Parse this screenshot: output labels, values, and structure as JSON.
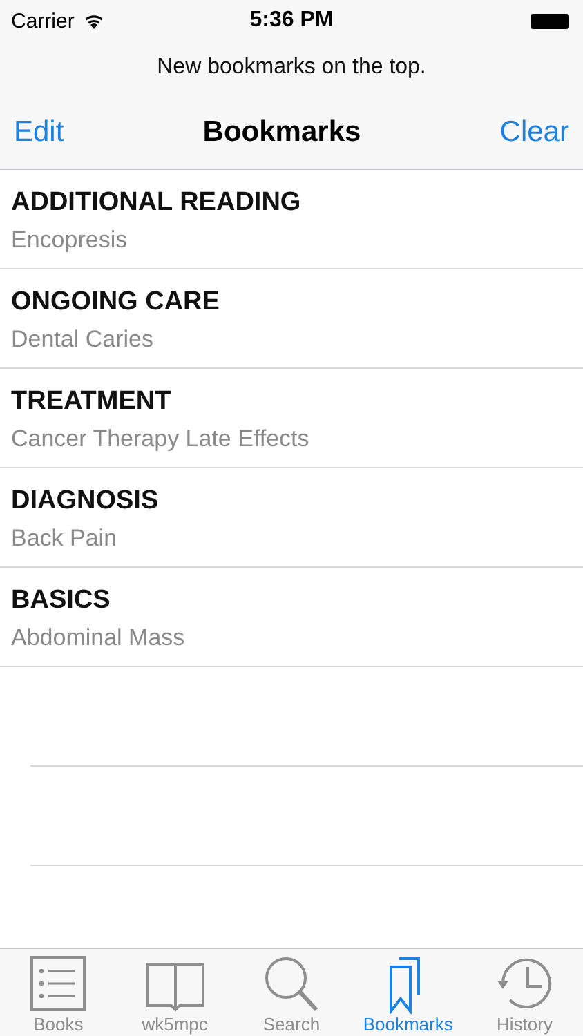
{
  "status_bar": {
    "carrier": "Carrier",
    "time": "5:36 PM"
  },
  "prompt": "New bookmarks on the top.",
  "nav": {
    "left": "Edit",
    "title": "Bookmarks",
    "right": "Clear"
  },
  "bookmarks": [
    {
      "section": "ADDITIONAL READING",
      "topic": "Encopresis"
    },
    {
      "section": "ONGOING CARE",
      "topic": "Dental Caries"
    },
    {
      "section": "TREATMENT",
      "topic": "Cancer Therapy Late Effects"
    },
    {
      "section": "DIAGNOSIS",
      "topic": "Back Pain"
    },
    {
      "section": "BASICS",
      "topic": "Abdominal Mass"
    }
  ],
  "tabs": [
    {
      "label": "Books",
      "kind": "list",
      "selected": false
    },
    {
      "label": "wk5mpc",
      "kind": "book",
      "selected": false
    },
    {
      "label": "Search",
      "kind": "search",
      "selected": false
    },
    {
      "label": "Bookmarks",
      "kind": "bookmarks",
      "selected": true
    },
    {
      "label": "History",
      "kind": "history",
      "selected": false
    }
  ]
}
